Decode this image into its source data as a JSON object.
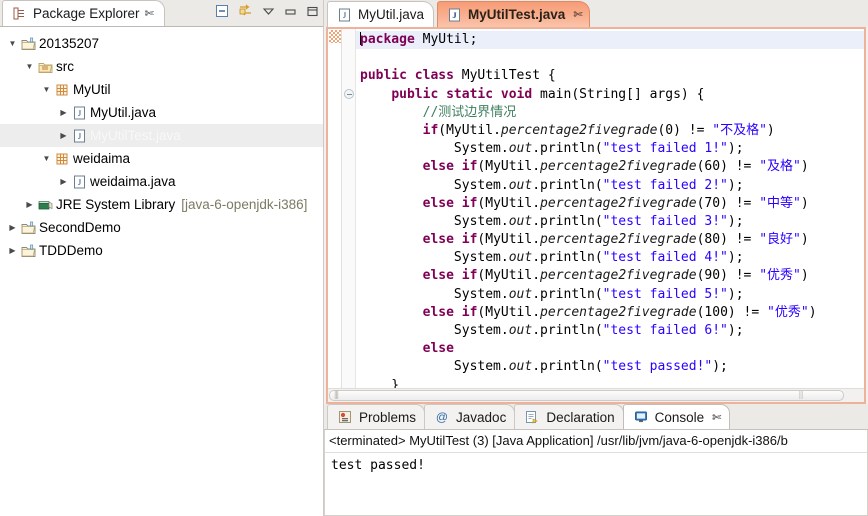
{
  "explorer": {
    "tab_label": "Package Explorer",
    "tab_icon": "package-explorer-icon",
    "tools": [
      {
        "name": "collapse-all-icon",
        "title": "Collapse All"
      },
      {
        "name": "link-with-editor-icon",
        "title": "Link with Editor"
      },
      {
        "name": "view-menu-icon",
        "title": "View Menu"
      },
      {
        "name": "minimize-icon",
        "title": "Minimize"
      },
      {
        "name": "maximize-icon",
        "title": "Maximize"
      }
    ],
    "tree": [
      {
        "label": "20135207",
        "icon": "project-icon",
        "indent": 0,
        "arrow": "down",
        "selected": false,
        "suffix": ""
      },
      {
        "label": "src",
        "icon": "source-folder-icon",
        "indent": 1,
        "arrow": "down",
        "selected": false,
        "suffix": ""
      },
      {
        "label": "MyUtil",
        "icon": "package-icon",
        "indent": 2,
        "arrow": "down",
        "selected": false,
        "suffix": ""
      },
      {
        "label": "MyUtil.java",
        "icon": "java-file-icon",
        "indent": 3,
        "arrow": "right",
        "selected": false,
        "suffix": ""
      },
      {
        "label": "MyUtilTest.java",
        "icon": "java-file-icon",
        "indent": 3,
        "arrow": "right",
        "selected": true,
        "suffix": ""
      },
      {
        "label": "weidaima",
        "icon": "package-icon",
        "indent": 2,
        "arrow": "down",
        "selected": false,
        "suffix": ""
      },
      {
        "label": "weidaima.java",
        "icon": "java-file-icon",
        "indent": 3,
        "arrow": "right",
        "selected": false,
        "suffix": ""
      },
      {
        "label": "JRE System Library",
        "icon": "library-icon",
        "indent": 1,
        "arrow": "right",
        "selected": false,
        "suffix": "[java-6-openjdk-i386]"
      },
      {
        "label": "SecondDemo",
        "icon": "project-icon",
        "indent": 0,
        "arrow": "right",
        "selected": false,
        "suffix": ""
      },
      {
        "label": "TDDDemo",
        "icon": "project-icon",
        "indent": 0,
        "arrow": "right",
        "selected": false,
        "suffix": ""
      }
    ]
  },
  "editor": {
    "tabs": [
      {
        "label": "MyUtil.java",
        "icon": "java-file-icon",
        "active": false,
        "closable": false
      },
      {
        "label": "MyUtilTest.java",
        "icon": "java-file-icon",
        "active": true,
        "closable": true
      }
    ],
    "close_glyph": "✄",
    "code_lines": [
      {
        "tokens": [
          {
            "t": "caret",
            "v": ""
          },
          {
            "t": "kw",
            "v": "package"
          },
          {
            "t": "pln",
            "v": " MyUtil;"
          }
        ],
        "highlight": true
      },
      {
        "tokens": [],
        "highlight": false
      },
      {
        "tokens": [
          {
            "t": "kw",
            "v": "public class"
          },
          {
            "t": "pln",
            "v": " MyUtilTest {"
          }
        ],
        "highlight": false
      },
      {
        "tokens": [
          {
            "t": "pln",
            "v": "    "
          },
          {
            "t": "kw",
            "v": "public static void"
          },
          {
            "t": "pln",
            "v": " main(String[] args) {"
          }
        ],
        "highlight": false
      },
      {
        "tokens": [
          {
            "t": "pln",
            "v": "        "
          },
          {
            "t": "cmt",
            "v": "//测试边界情况"
          }
        ],
        "highlight": false
      },
      {
        "tokens": [
          {
            "t": "pln",
            "v": "        "
          },
          {
            "t": "kw",
            "v": "if"
          },
          {
            "t": "pln",
            "v": "(MyUtil."
          },
          {
            "t": "mth",
            "v": "percentage2fivegrade"
          },
          {
            "t": "pln",
            "v": "(0) != "
          },
          {
            "t": "str",
            "v": "\"不及格\""
          },
          {
            "t": "pln",
            "v": ")"
          }
        ],
        "highlight": false
      },
      {
        "tokens": [
          {
            "t": "pln",
            "v": "            System."
          },
          {
            "t": "fld",
            "v": "out"
          },
          {
            "t": "pln",
            "v": ".println("
          },
          {
            "t": "str",
            "v": "\"test failed 1!\""
          },
          {
            "t": "pln",
            "v": ");"
          }
        ],
        "highlight": false
      },
      {
        "tokens": [
          {
            "t": "pln",
            "v": "        "
          },
          {
            "t": "kw",
            "v": "else if"
          },
          {
            "t": "pln",
            "v": "(MyUtil."
          },
          {
            "t": "mth",
            "v": "percentage2fivegrade"
          },
          {
            "t": "pln",
            "v": "(60) != "
          },
          {
            "t": "str",
            "v": "\"及格\""
          },
          {
            "t": "pln",
            "v": ")"
          }
        ],
        "highlight": false
      },
      {
        "tokens": [
          {
            "t": "pln",
            "v": "            System."
          },
          {
            "t": "fld",
            "v": "out"
          },
          {
            "t": "pln",
            "v": ".println("
          },
          {
            "t": "str",
            "v": "\"test failed 2!\""
          },
          {
            "t": "pln",
            "v": ");"
          }
        ],
        "highlight": false
      },
      {
        "tokens": [
          {
            "t": "pln",
            "v": "        "
          },
          {
            "t": "kw",
            "v": "else if"
          },
          {
            "t": "pln",
            "v": "(MyUtil."
          },
          {
            "t": "mth",
            "v": "percentage2fivegrade"
          },
          {
            "t": "pln",
            "v": "(70) != "
          },
          {
            "t": "str",
            "v": "\"中等\""
          },
          {
            "t": "pln",
            "v": ")"
          }
        ],
        "highlight": false
      },
      {
        "tokens": [
          {
            "t": "pln",
            "v": "            System."
          },
          {
            "t": "fld",
            "v": "out"
          },
          {
            "t": "pln",
            "v": ".println("
          },
          {
            "t": "str",
            "v": "\"test failed 3!\""
          },
          {
            "t": "pln",
            "v": ");"
          }
        ],
        "highlight": false
      },
      {
        "tokens": [
          {
            "t": "pln",
            "v": "        "
          },
          {
            "t": "kw",
            "v": "else if"
          },
          {
            "t": "pln",
            "v": "(MyUtil."
          },
          {
            "t": "mth",
            "v": "percentage2fivegrade"
          },
          {
            "t": "pln",
            "v": "(80) != "
          },
          {
            "t": "str",
            "v": "\"良好\""
          },
          {
            "t": "pln",
            "v": ")"
          }
        ],
        "highlight": false
      },
      {
        "tokens": [
          {
            "t": "pln",
            "v": "            System."
          },
          {
            "t": "fld",
            "v": "out"
          },
          {
            "t": "pln",
            "v": ".println("
          },
          {
            "t": "str",
            "v": "\"test failed 4!\""
          },
          {
            "t": "pln",
            "v": ");"
          }
        ],
        "highlight": false
      },
      {
        "tokens": [
          {
            "t": "pln",
            "v": "        "
          },
          {
            "t": "kw",
            "v": "else if"
          },
          {
            "t": "pln",
            "v": "(MyUtil."
          },
          {
            "t": "mth",
            "v": "percentage2fivegrade"
          },
          {
            "t": "pln",
            "v": "(90) != "
          },
          {
            "t": "str",
            "v": "\"优秀\""
          },
          {
            "t": "pln",
            "v": ")"
          }
        ],
        "highlight": false
      },
      {
        "tokens": [
          {
            "t": "pln",
            "v": "            System."
          },
          {
            "t": "fld",
            "v": "out"
          },
          {
            "t": "pln",
            "v": ".println("
          },
          {
            "t": "str",
            "v": "\"test failed 5!\""
          },
          {
            "t": "pln",
            "v": ");"
          }
        ],
        "highlight": false
      },
      {
        "tokens": [
          {
            "t": "pln",
            "v": "        "
          },
          {
            "t": "kw",
            "v": "else if"
          },
          {
            "t": "pln",
            "v": "(MyUtil."
          },
          {
            "t": "mth",
            "v": "percentage2fivegrade"
          },
          {
            "t": "pln",
            "v": "(100) != "
          },
          {
            "t": "str",
            "v": "\"优秀\""
          },
          {
            "t": "pln",
            "v": ")"
          }
        ],
        "highlight": false
      },
      {
        "tokens": [
          {
            "t": "pln",
            "v": "            System."
          },
          {
            "t": "fld",
            "v": "out"
          },
          {
            "t": "pln",
            "v": ".println("
          },
          {
            "t": "str",
            "v": "\"test failed 6!\""
          },
          {
            "t": "pln",
            "v": ");"
          }
        ],
        "highlight": false
      },
      {
        "tokens": [
          {
            "t": "pln",
            "v": "        "
          },
          {
            "t": "kw",
            "v": "else"
          }
        ],
        "highlight": false
      },
      {
        "tokens": [
          {
            "t": "pln",
            "v": "            System."
          },
          {
            "t": "fld",
            "v": "out"
          },
          {
            "t": "pln",
            "v": ".println("
          },
          {
            "t": "str",
            "v": "\"test passed!\""
          },
          {
            "t": "pln",
            "v": ");"
          }
        ],
        "highlight": false
      },
      {
        "tokens": [
          {
            "t": "pln",
            "v": "    }"
          }
        ],
        "highlight": false
      },
      {
        "tokens": [
          {
            "t": "pln",
            "v": "}"
          }
        ],
        "highlight": false
      }
    ]
  },
  "bottom_panel": {
    "tabs": [
      {
        "label": "Problems",
        "icon": "problems-icon",
        "active": false,
        "closable": false
      },
      {
        "label": "Javadoc",
        "icon": "javadoc-icon",
        "active": false,
        "closable": false
      },
      {
        "label": "Declaration",
        "icon": "declaration-icon",
        "active": false,
        "closable": false
      },
      {
        "label": "Console",
        "icon": "console-icon",
        "active": true,
        "closable": true
      }
    ],
    "close_glyph": "✄",
    "console": {
      "header": "<terminated> MyUtilTest (3) [Java Application] /usr/lib/jvm/java-6-openjdk-i386/b",
      "output": "test passed!"
    }
  },
  "colors": {
    "active_tab": "#f79c76",
    "editor_frame": "#eeb199",
    "keyword": "#7f0055",
    "string": "#2a00ff",
    "comment": "#3f7f5f",
    "selection": "#ededed",
    "current_line": "#eaeffa"
  }
}
